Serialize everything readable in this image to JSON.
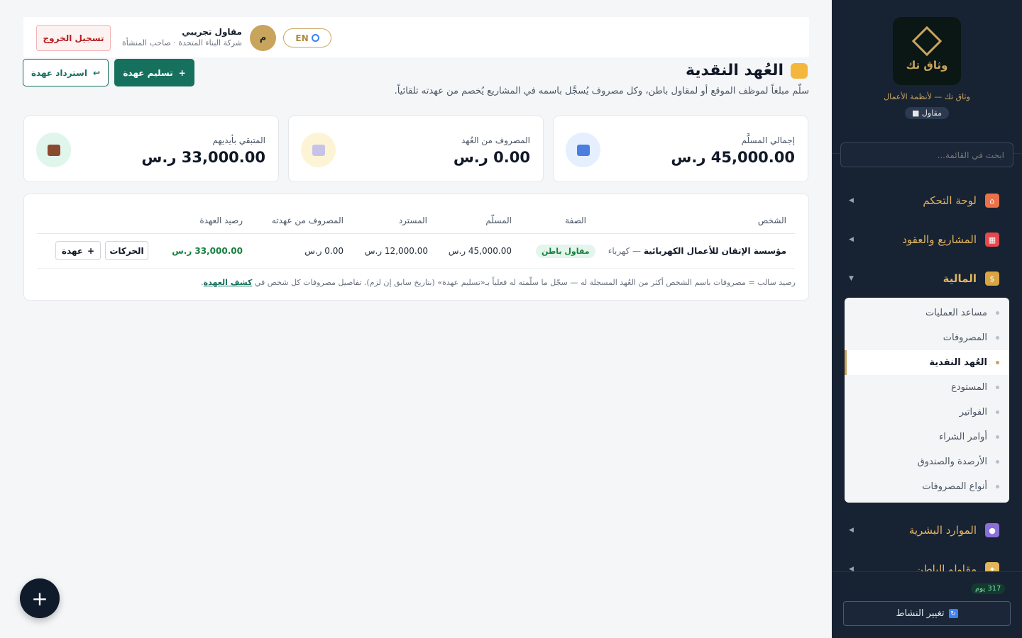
{
  "sidebar": {
    "logo_text": "وثاق تك",
    "brand_subtitle": "وثاق تك — لأنظمة الأعمال",
    "role_badge": "مقاول",
    "search_placeholder": "ابحث في القائمة...",
    "nav": [
      {
        "label": "لوحة التحكم",
        "icon": "home-icon",
        "icon_color": "#e8734a"
      },
      {
        "label": "المشاريع والعقود",
        "icon": "construction-icon",
        "icon_color": "#e5484d"
      },
      {
        "label": "المالية",
        "icon": "money-bag-icon",
        "icon_color": "#d9a441"
      },
      {
        "label": "الموارد البشرية",
        "icon": "worker-icon",
        "icon_color": "#8b6fd6"
      },
      {
        "label": "مقاولو الباطن",
        "icon": "handshake-icon",
        "icon_color": "#e3b55b"
      }
    ],
    "finance_sub": [
      {
        "label": "مساعد العمليات"
      },
      {
        "label": "المصروفات"
      },
      {
        "label": "العُهد النقدية"
      },
      {
        "label": "المستودع"
      },
      {
        "label": "الفواتير"
      },
      {
        "label": "أوامر الشراء"
      },
      {
        "label": "الأرصدة والصندوق"
      },
      {
        "label": "أنواع المصروفات"
      }
    ],
    "days_badge": "317 يوم",
    "switch_activity": "تغيير النشاط"
  },
  "topbar": {
    "lang": "EN",
    "avatar_letter": "م",
    "user_name": "مقاول تجريبي",
    "user_sub": "شركة البناء المتحدة · صاحب المنشأة",
    "logout": "تسجيل الخروج"
  },
  "page": {
    "title": "العُهد النقدية",
    "description": "سلّم مبلغاً لموظف الموقع أو لمقاول باطن، وكل مصروف يُسجَّل باسمه في المشاريع يُخصم من عهدته تلقائياً.",
    "btn_deliver": "تسليم عهدة",
    "btn_deliver_icon": "+",
    "btn_recover": "استرداد عهدة",
    "btn_recover_icon": "↩"
  },
  "stats": [
    {
      "label": "إجمالي المسلَّم",
      "value": "45,000.00 ر.س",
      "icon": "outbox-icon",
      "color": "#e6effd"
    },
    {
      "label": "المصروف من العُهد",
      "value": "0.00 ر.س",
      "icon": "receipt-icon",
      "color": "#fdf4d6"
    },
    {
      "label": "المتبقي بأيديهم",
      "value": "33,000.00 ر.س",
      "icon": "briefcase-icon",
      "color": "#e0f5ec"
    }
  ],
  "table": {
    "headers": {
      "person": "الشخص",
      "type": "الصفة",
      "delivered": "المسلّم",
      "recovered": "المسترد",
      "spent": "المصروف من عهدته",
      "balance": "رصيد العهدة"
    },
    "rows": [
      {
        "person": "مؤسسة الإتقان للأعمال الكهربائية",
        "trade": " — كهرباء",
        "type": "مقاول باطن",
        "delivered": "45,000.00 ر.س",
        "recovered": "12,000.00 ر.س",
        "spent": "0.00 ر.س",
        "balance": "33,000.00 ر.س",
        "btn_moves": "الحركات",
        "btn_add": "عهدة",
        "btn_add_icon": "+"
      }
    ],
    "note": "رصيد سالب = مصروفات باسم الشخص أكثر من العُهد المسجلة له — سجّل ما سلّمته له فعلياً بـ«تسليم عهدة» (بتاريخ سابق إن لزم). تفاصيل مصروفات كل شخص في ",
    "note_link": "كشف العهدة",
    "note_end": "."
  },
  "fab": "+"
}
